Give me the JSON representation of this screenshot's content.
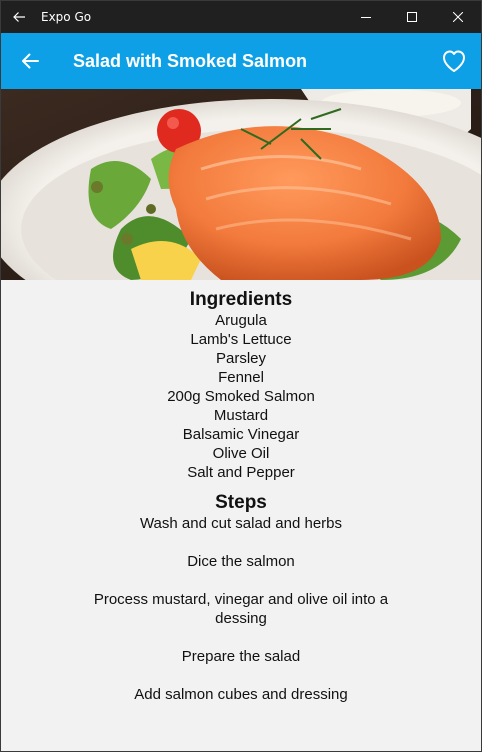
{
  "window": {
    "title": "Expo Go"
  },
  "appbar": {
    "title": "Salad with Smoked Salmon",
    "background": "#0ea0e6"
  },
  "icons": {
    "titlebar_back": "arrow-left-icon",
    "minimize": "minimize-icon",
    "maximize": "maximize-icon",
    "close": "close-icon",
    "back": "arrow-left-icon",
    "favorite": "heart-outline-icon"
  },
  "hero_image": {
    "subject": "salad-with-smoked-salmon-photo"
  },
  "ingredients": {
    "title": "Ingredients",
    "items": [
      "Arugula",
      "Lamb's Lettuce",
      "Parsley",
      "Fennel",
      "200g Smoked Salmon",
      "Mustard",
      "Balsamic Vinegar",
      "Olive Oil",
      "Salt and Pepper"
    ]
  },
  "steps": {
    "title": "Steps",
    "items": [
      "Wash and cut salad and herbs",
      "Dice the salmon",
      "Process mustard, vinegar and olive oil into a dessing",
      "Prepare the salad",
      "Add salmon cubes and dressing"
    ]
  }
}
